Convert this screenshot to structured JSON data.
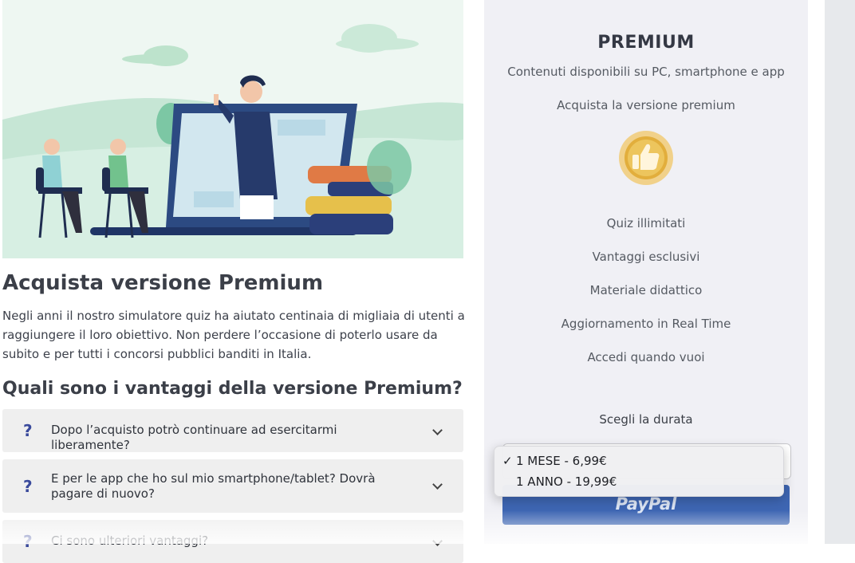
{
  "main": {
    "title": "Acquista versione Premium",
    "intro": "Negli anni il nostro simulatore quiz ha aiutato centinaia di migliaia di utenti a raggiungere il loro obiettivo. Non perdere l’occasione di poterlo usare da subito e per tutti i concorsi pubblici banditi in Italia.",
    "faq_title": "Quali sono i vantaggi della versione Premium?",
    "faq": [
      {
        "q": "?",
        "text": "Dopo l’acquisto potrò continuare ad esercitarmi liberamente?"
      },
      {
        "q": "?",
        "text": "E per le app che ho sul mio smartphone/tablet? Dovrà pagare di nuovo?"
      },
      {
        "q": "?",
        "text": "Ci sono ulteriori vantaggi?"
      }
    ]
  },
  "panel": {
    "title": "PREMIUM",
    "subtitle": "Contenuti disponibili su PC, smartphone e app",
    "cta": "Acquista la versione premium",
    "badge_icon": "thumbs-up-icon",
    "features": [
      "Quiz illimitati",
      "Vantaggi esclusivi",
      "Materiale didattico",
      "Aggiornamento in Real Time",
      "Accedi quando vuoi"
    ],
    "duration_label": "Scegli la durata",
    "options": [
      {
        "label": "1 MESE - 6,99€",
        "selected": true
      },
      {
        "label": "1 ANNO - 19,99€",
        "selected": false
      }
    ],
    "check": "✓",
    "paypal_label": "PayPal"
  },
  "colors": {
    "accent": "#3e66b3",
    "panel_bg": "#f0f0f5",
    "faq_bg": "#efefef",
    "hero_bg": "#d9efe4"
  }
}
